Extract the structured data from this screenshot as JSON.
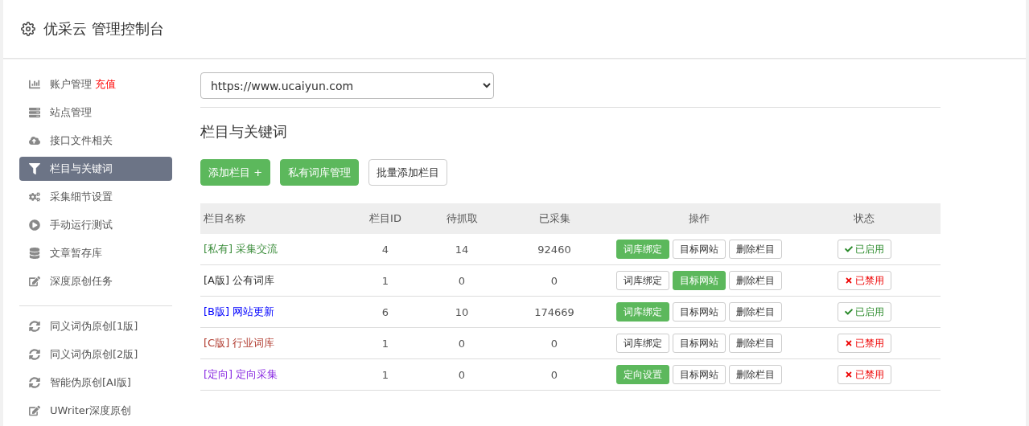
{
  "header": {
    "title": "优采云 管理控制台"
  },
  "sidebar": {
    "items": [
      {
        "label": "账户管理",
        "badge": "充值",
        "selected": false
      },
      {
        "label": "站点管理",
        "selected": false
      },
      {
        "label": "接口文件相关",
        "selected": false
      },
      {
        "label": "栏目与关键词",
        "selected": true
      },
      {
        "label": "采集细节设置",
        "selected": false
      },
      {
        "label": "手动运行测试",
        "selected": false
      },
      {
        "label": "文章暂存库",
        "selected": false
      },
      {
        "label": "深度原创任务",
        "selected": false
      }
    ],
    "tools": [
      {
        "label": "同义词伪原创[1版]"
      },
      {
        "label": "同义词伪原创[2版]"
      },
      {
        "label": "智能伪原创[AI版]"
      },
      {
        "label": "UWriter深度原创"
      }
    ]
  },
  "site_select": {
    "value": "https://www.ucaiyun.com"
  },
  "section_title": "栏目与关键词",
  "actions": [
    {
      "label": "添加栏目 +",
      "primary": true
    },
    {
      "label": "私有词库管理",
      "primary": true
    },
    {
      "label": "批量添加栏目",
      "primary": false
    }
  ],
  "table": {
    "columns": [
      "栏目名称",
      "栏目ID",
      "待抓取",
      "已采集",
      "操作",
      "状态"
    ],
    "rows": [
      {
        "tag": "[私有]",
        "name": "采集交流",
        "color": "#3c8d3c",
        "id": "4",
        "pending": "14",
        "collected": "92460",
        "ops": [
          {
            "label": "词库绑定",
            "highlighted": true
          },
          {
            "label": "目标网站",
            "highlighted": false
          },
          {
            "label": "删除栏目",
            "highlighted": false
          }
        ],
        "status": "已启用",
        "enabled": true
      },
      {
        "tag": "[A版]",
        "name": "公有词库",
        "color": "#333333",
        "id": "1",
        "pending": "0",
        "collected": "0",
        "ops": [
          {
            "label": "词库绑定",
            "highlighted": false
          },
          {
            "label": "目标网站",
            "highlighted": true
          },
          {
            "label": "删除栏目",
            "highlighted": false
          }
        ],
        "status": "已禁用",
        "enabled": false
      },
      {
        "tag": "[B版]",
        "name": "网站更新",
        "color": "#0000ff",
        "id": "6",
        "pending": "10",
        "collected": "174669",
        "ops": [
          {
            "label": "词库绑定",
            "highlighted": true
          },
          {
            "label": "目标网站",
            "highlighted": false
          },
          {
            "label": "删除栏目",
            "highlighted": false
          }
        ],
        "status": "已启用",
        "enabled": true
      },
      {
        "tag": "[C版]",
        "name": "行业词库",
        "color": "#b03a2e",
        "id": "1",
        "pending": "0",
        "collected": "0",
        "ops": [
          {
            "label": "词库绑定",
            "highlighted": false
          },
          {
            "label": "目标网站",
            "highlighted": false
          },
          {
            "label": "删除栏目",
            "highlighted": false
          }
        ],
        "status": "已禁用",
        "enabled": false
      },
      {
        "tag": "[定向]",
        "name": "定向采集",
        "color": "#8a2be2",
        "id": "1",
        "pending": "0",
        "collected": "0",
        "ops": [
          {
            "label": "定向设置",
            "highlighted": true
          },
          {
            "label": "目标网站",
            "highlighted": false
          },
          {
            "label": "删除栏目",
            "highlighted": false
          }
        ],
        "status": "已禁用",
        "enabled": false
      }
    ]
  }
}
